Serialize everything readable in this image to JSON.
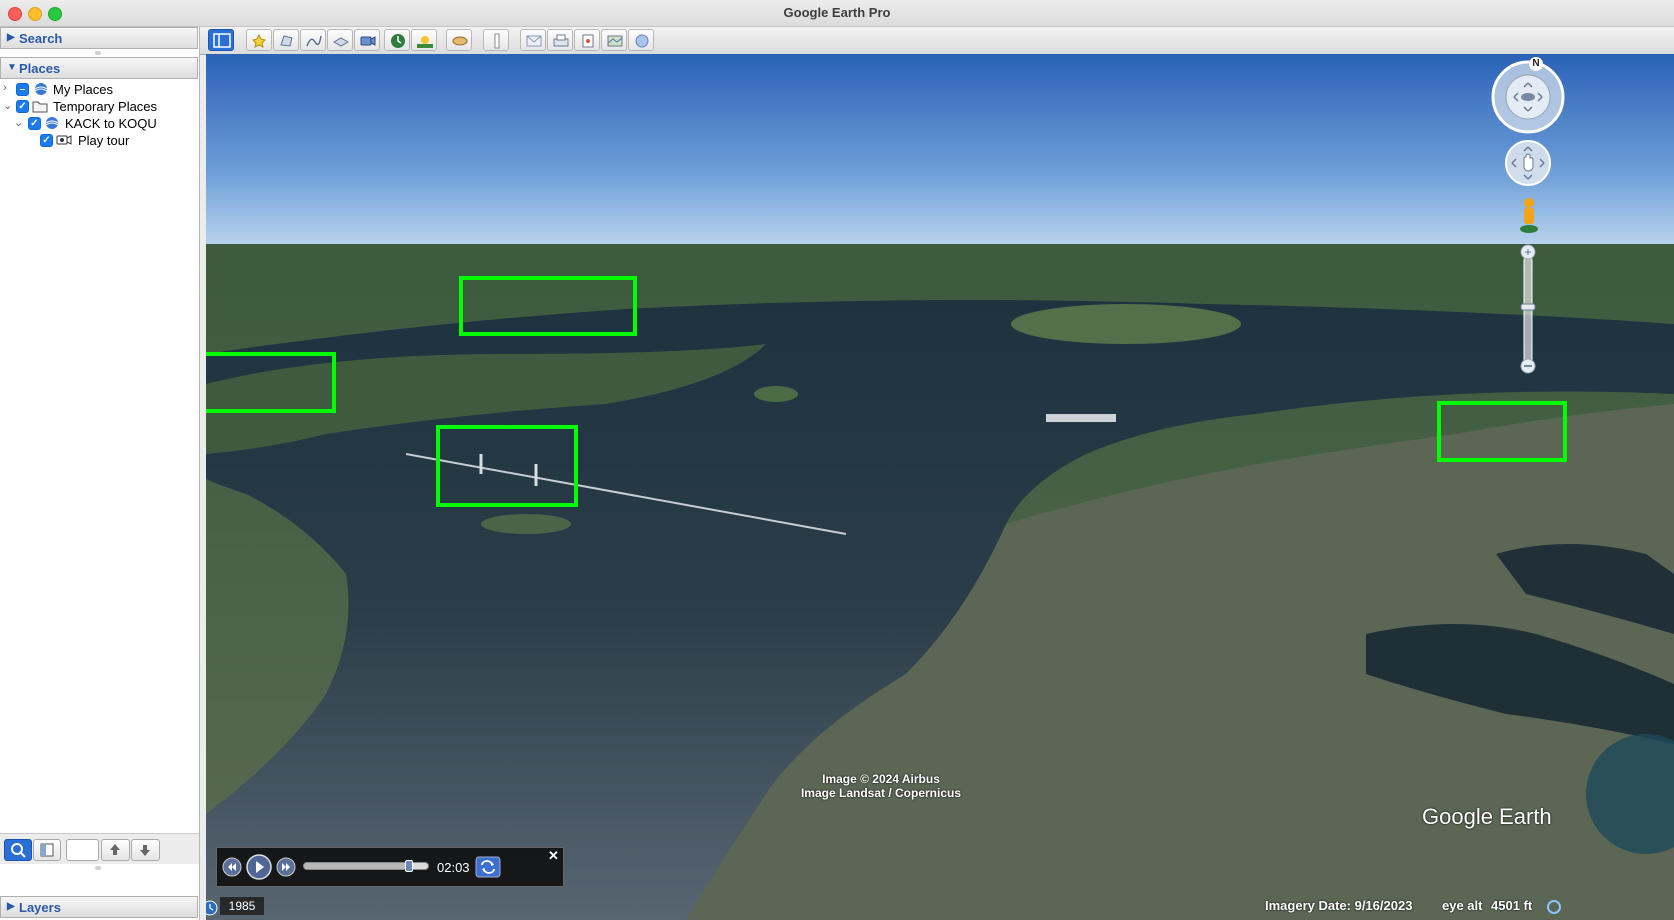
{
  "window": {
    "title": "Google Earth Pro"
  },
  "sidebar": {
    "search_header": "Search",
    "places_header": "Places",
    "layers_header": "Layers",
    "tree": [
      {
        "label": "My Places",
        "icon": "folder-globe-icon",
        "checked": "partial"
      },
      {
        "label": "Temporary Places",
        "icon": "folder-open-icon",
        "checked": true
      },
      {
        "label": "KACK to KOQU",
        "icon": "tour-globe-icon",
        "checked": true
      },
      {
        "label": "Play tour",
        "icon": "camera-tour-icon",
        "checked": true
      }
    ]
  },
  "toolbar": {
    "buttons": [
      "sidebar-toggle-icon",
      "placemark-icon",
      "polygon-icon",
      "path-icon",
      "overlay-icon",
      "record-tour-icon",
      "historical-imagery-icon",
      "sunlight-icon",
      "planets-icon",
      "ruler-icon",
      "email-icon",
      "print-icon",
      "save-image-icon",
      "view-in-maps-icon",
      "earth-icon"
    ]
  },
  "viewport": {
    "credits": [
      "Image © 2024 Airbus",
      "Image Landsat / Copernicus"
    ],
    "logo": "Google Earth",
    "compass_letter": "N"
  },
  "tour_player": {
    "time": "02:03",
    "progress": 0.85
  },
  "status_bar": {
    "year": "1985",
    "imagery_date": "Imagery Date: 9/16/2023",
    "eye_alt_label": "eye alt",
    "eye_alt_value": "4501 ft"
  },
  "colors": {
    "highlight": "#00ff00",
    "accent": "#1a7cf0"
  }
}
